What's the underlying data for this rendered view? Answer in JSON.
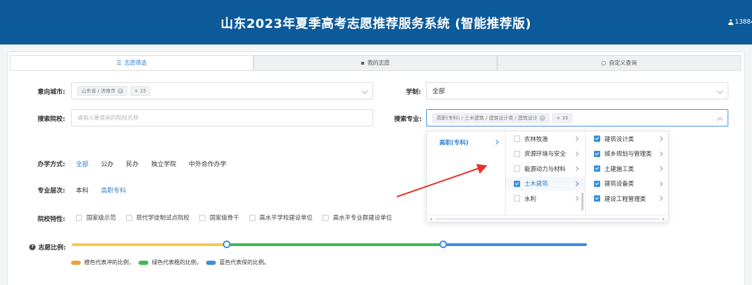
{
  "header": {
    "title": "山东2023年夏季高考志愿推荐服务系统 (智能推荐版)",
    "user": "13884"
  },
  "tabs": [
    {
      "label": "志愿筛选",
      "icon": "filter-icon",
      "active": true
    },
    {
      "label": "我的志愿",
      "icon": "trash-icon",
      "active": false
    },
    {
      "label": "自定义查询",
      "icon": "circle-icon",
      "active": false
    }
  ],
  "form": {
    "city": {
      "label": "意向城市:",
      "tag": "山东省 / 济南市",
      "more": "+ 15"
    },
    "duration": {
      "label": "学制:",
      "value": "全部"
    },
    "school": {
      "label": "搜索院校:",
      "placeholder": "请输入要查询的院校名称"
    },
    "major": {
      "label": "搜索专业:",
      "tag": "高职(专科) / 土木建筑 / 建筑设计类 / 建筑设计",
      "more": "+ 33"
    },
    "ownership": {
      "label": "办学方式:",
      "options": [
        "全部",
        "公办",
        "民办",
        "独立学院",
        "中外合作办学"
      ],
      "active_index": 0
    },
    "level": {
      "label": "专业层次:",
      "options": [
        "本科",
        "高职专科"
      ],
      "active_index": 1
    },
    "traits": {
      "label": "院校特性:",
      "options": [
        "国家级示范",
        "现代学徒制试点院校",
        "国家级骨干",
        "高水平学校建设单位",
        "高水平专业群建设单位"
      ]
    }
  },
  "cascader": {
    "col1": [
      {
        "label": "高职(专科)",
        "active": true
      }
    ],
    "col2": [
      {
        "label": "农林牧渔",
        "checked": false
      },
      {
        "label": "资源环境与安全",
        "checked": false
      },
      {
        "label": "能源动力与材料",
        "checked": false
      },
      {
        "label": "土木建筑",
        "checked": true,
        "selected": true
      },
      {
        "label": "水利",
        "checked": false
      }
    ],
    "col3": [
      {
        "label": "建筑设计类",
        "checked": true
      },
      {
        "label": "城乡规划与管理类",
        "checked": true
      },
      {
        "label": "土建施工类",
        "checked": true
      },
      {
        "label": "建筑设备类",
        "checked": true
      },
      {
        "label": "建设工程管理类",
        "checked": true
      }
    ]
  },
  "ratio": {
    "label": "志愿比例:",
    "split_percent": [
      30,
      42,
      28
    ],
    "colors": {
      "orange": "#f7c948",
      "green": "#3fb950",
      "blue": "#3b8de0"
    },
    "legend": [
      "橙色代表冲的比例，",
      "绿色代表稳的比例，",
      "蓝色代表保的比例。"
    ]
  }
}
